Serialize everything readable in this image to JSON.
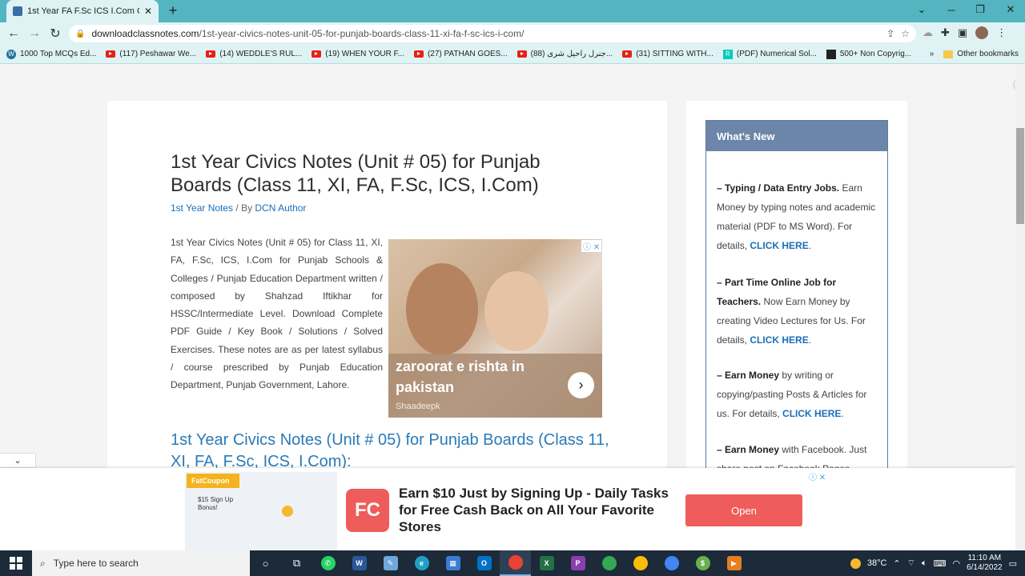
{
  "browser": {
    "tab_title": "1st Year FA F.Sc ICS I.Com Class-",
    "url_host": "downloadclassnotes.com",
    "url_path": "/1st-year-civics-notes-unit-05-for-punjab-boards-class-11-xi-fa-f-sc-ics-i-com/",
    "new_tab_label": "+",
    "bookmarks": [
      {
        "label": "1000 Top MCQs Ed...",
        "icon": "wordpress-icon"
      },
      {
        "label": "(117) Peshawar We...",
        "icon": "youtube-icon"
      },
      {
        "label": "(14) WEDDLE'S RUL...",
        "icon": "youtube-icon"
      },
      {
        "label": "(19) WHEN YOUR F...",
        "icon": "youtube-icon"
      },
      {
        "label": "(27) PATHAN GOES...",
        "icon": "youtube-icon"
      },
      {
        "label": "(88) جنرل راحیل شری...",
        "icon": "youtube-icon"
      },
      {
        "label": "(31) SITTING WITH...",
        "icon": "youtube-icon"
      },
      {
        "label": "(PDF) Numerical Sol...",
        "icon": "researchgate-icon"
      },
      {
        "label": "500+ Non Copyrig...",
        "icon": "page-icon"
      }
    ],
    "more_bookmarks": "»",
    "other_bookmarks": "Other bookmarks"
  },
  "article": {
    "title": "1st Year Civics Notes (Unit # 05) for Punjab Boards (Class 11, XI, FA, F.Sc, ICS, I.Com)",
    "category": "1st Year Notes",
    "by": " / By ",
    "author": "DCN Author",
    "body": "1st Year Civics Notes (Unit # 05) for Class 11, XI, FA, F.Sc, ICS, I.Com for Punjab Schools & Colleges / Punjab Education Department written / composed by Shahzad Iftikhar for HSSC/Intermediate Level. Download Complete PDF Guide / Key Book / Solutions / Solved Exercises. These notes are as per latest syllabus / course prescribed by Punjab Education Department, Punjab Government, Lahore.",
    "subheading": "1st Year Civics Notes (Unit # 05) for Punjab Boards (Class 11, XI, FA, F.Sc, ICS, I.Com):"
  },
  "inline_ad": {
    "headline": "zaroorat e rishta in pakistan",
    "source": "Shaadeepk",
    "arrow": "›",
    "adchoices": "ⓘ ✕"
  },
  "sidebar": {
    "heading": "What's New",
    "items": [
      {
        "bold": "– Typing / Data Entry Jobs.",
        "text": " Earn Money by typing notes and academic material (PDF to MS Word). For details, ",
        "link": "CLICK HERE",
        "end": "."
      },
      {
        "bold": "– Part Time Online Job for Teachers.",
        "text": " Now Earn Money by creating Video Lectures for Us. For details, ",
        "link": "CLICK HERE",
        "end": "."
      },
      {
        "bold": "– Earn Money",
        "text": " by writing or copying/pasting Posts & Articles for us. For details, ",
        "link": "CLICK HERE",
        "end": "."
      },
      {
        "bold": "– Earn Money",
        "text": " with Facebook. Just share post on Facebook Pages",
        "link": "",
        "end": ""
      }
    ]
  },
  "bottom_ad": {
    "brand_small": "FatCoupon",
    "bonus": "$15 Sign Up Bonus!",
    "logo": "FC",
    "text": "Earn $10 Just by Signing Up - Daily Tasks for Free Cash Back on All Your Favorite Stores",
    "button": "Open",
    "adchoices": "ⓘ ✕"
  },
  "collapse_label": "⌄",
  "taskbar": {
    "search_placeholder": "Type here to search",
    "temperature": "38°C",
    "time": "11:10 AM",
    "date": "6/14/2022"
  }
}
